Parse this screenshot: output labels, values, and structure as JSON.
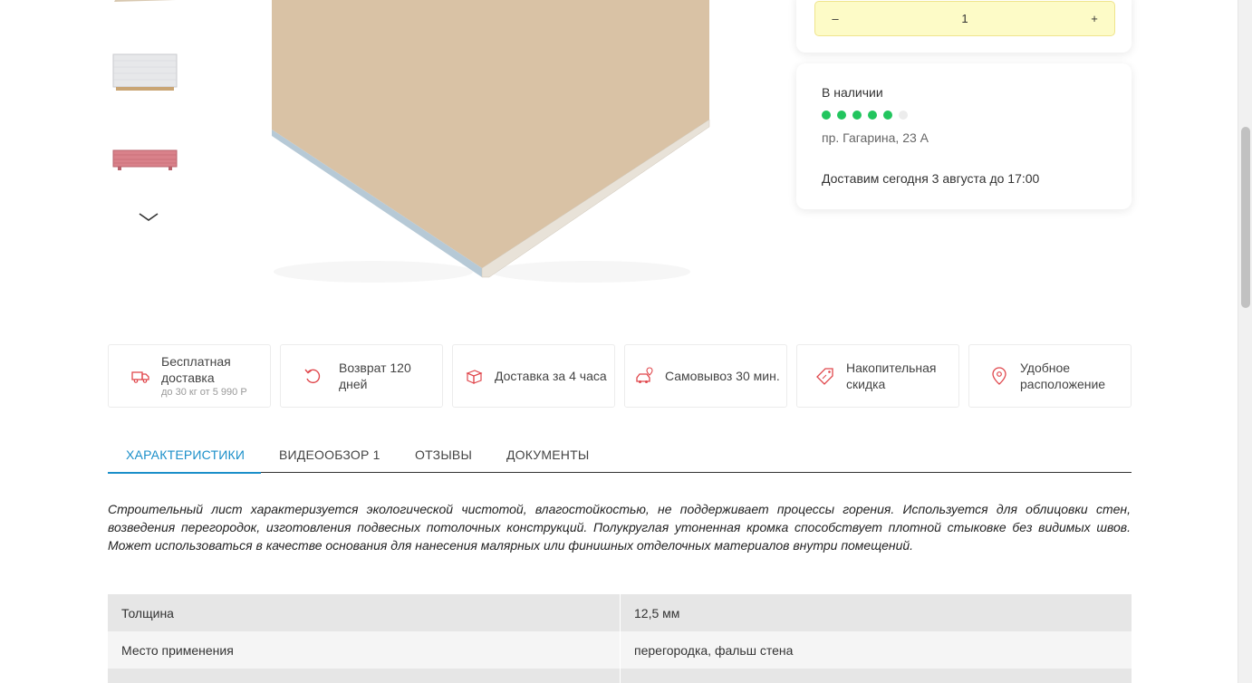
{
  "quantity": {
    "minus": "–",
    "value": "1",
    "plus": "+"
  },
  "stock": {
    "title": "В наличии",
    "level": 5,
    "max": 6,
    "address": "пр. Гагарина, 23 А",
    "delivery": "Доставим сегодня 3 августа до 17:00"
  },
  "features": [
    {
      "icon": "delivery-truck-icon",
      "title": "Бесплатная доставка",
      "subtitle": "до 30 кг от 5 990 Р"
    },
    {
      "icon": "return-arrow-icon",
      "title": "Возврат 120 дней"
    },
    {
      "icon": "box-icon",
      "title": "Доставка за 4 часа"
    },
    {
      "icon": "car-pin-icon",
      "title": "Самовывоз 30 мин."
    },
    {
      "icon": "discount-tag-icon",
      "title": "Накопительная скидка"
    },
    {
      "icon": "location-pin-icon",
      "title": "Удобное расположение"
    }
  ],
  "tabs": [
    {
      "label": "ХАРАКТЕРИСТИКИ",
      "active": true
    },
    {
      "label": "ВИДЕООБЗОР 1"
    },
    {
      "label": "ОТЗЫВЫ"
    },
    {
      "label": "ДОКУМЕНТЫ"
    }
  ],
  "description": "Строительный лист характеризуется экологической чистотой, влагостойкостью, не поддерживает процессы горения. Используется для облицовки стен, возведения перегородок, изготовления подвесных потолочных конструкций. Полукруглая утоненная кромка способствует плотной стыковке без видимых швов. Может использоваться в качестве основания для нанесения малярных или финишных отделочных материалов внутри помещений.",
  "specs": [
    {
      "name": "Толщина",
      "value": "12,5 мм"
    },
    {
      "name": "Место применения",
      "value": "перегородка, фальш стена"
    }
  ],
  "colors": {
    "accent": "#1b8fc9",
    "stock_dot": "#22c55e",
    "qty_bg": "#fdfbc7",
    "icon_red": "#e0474c"
  }
}
